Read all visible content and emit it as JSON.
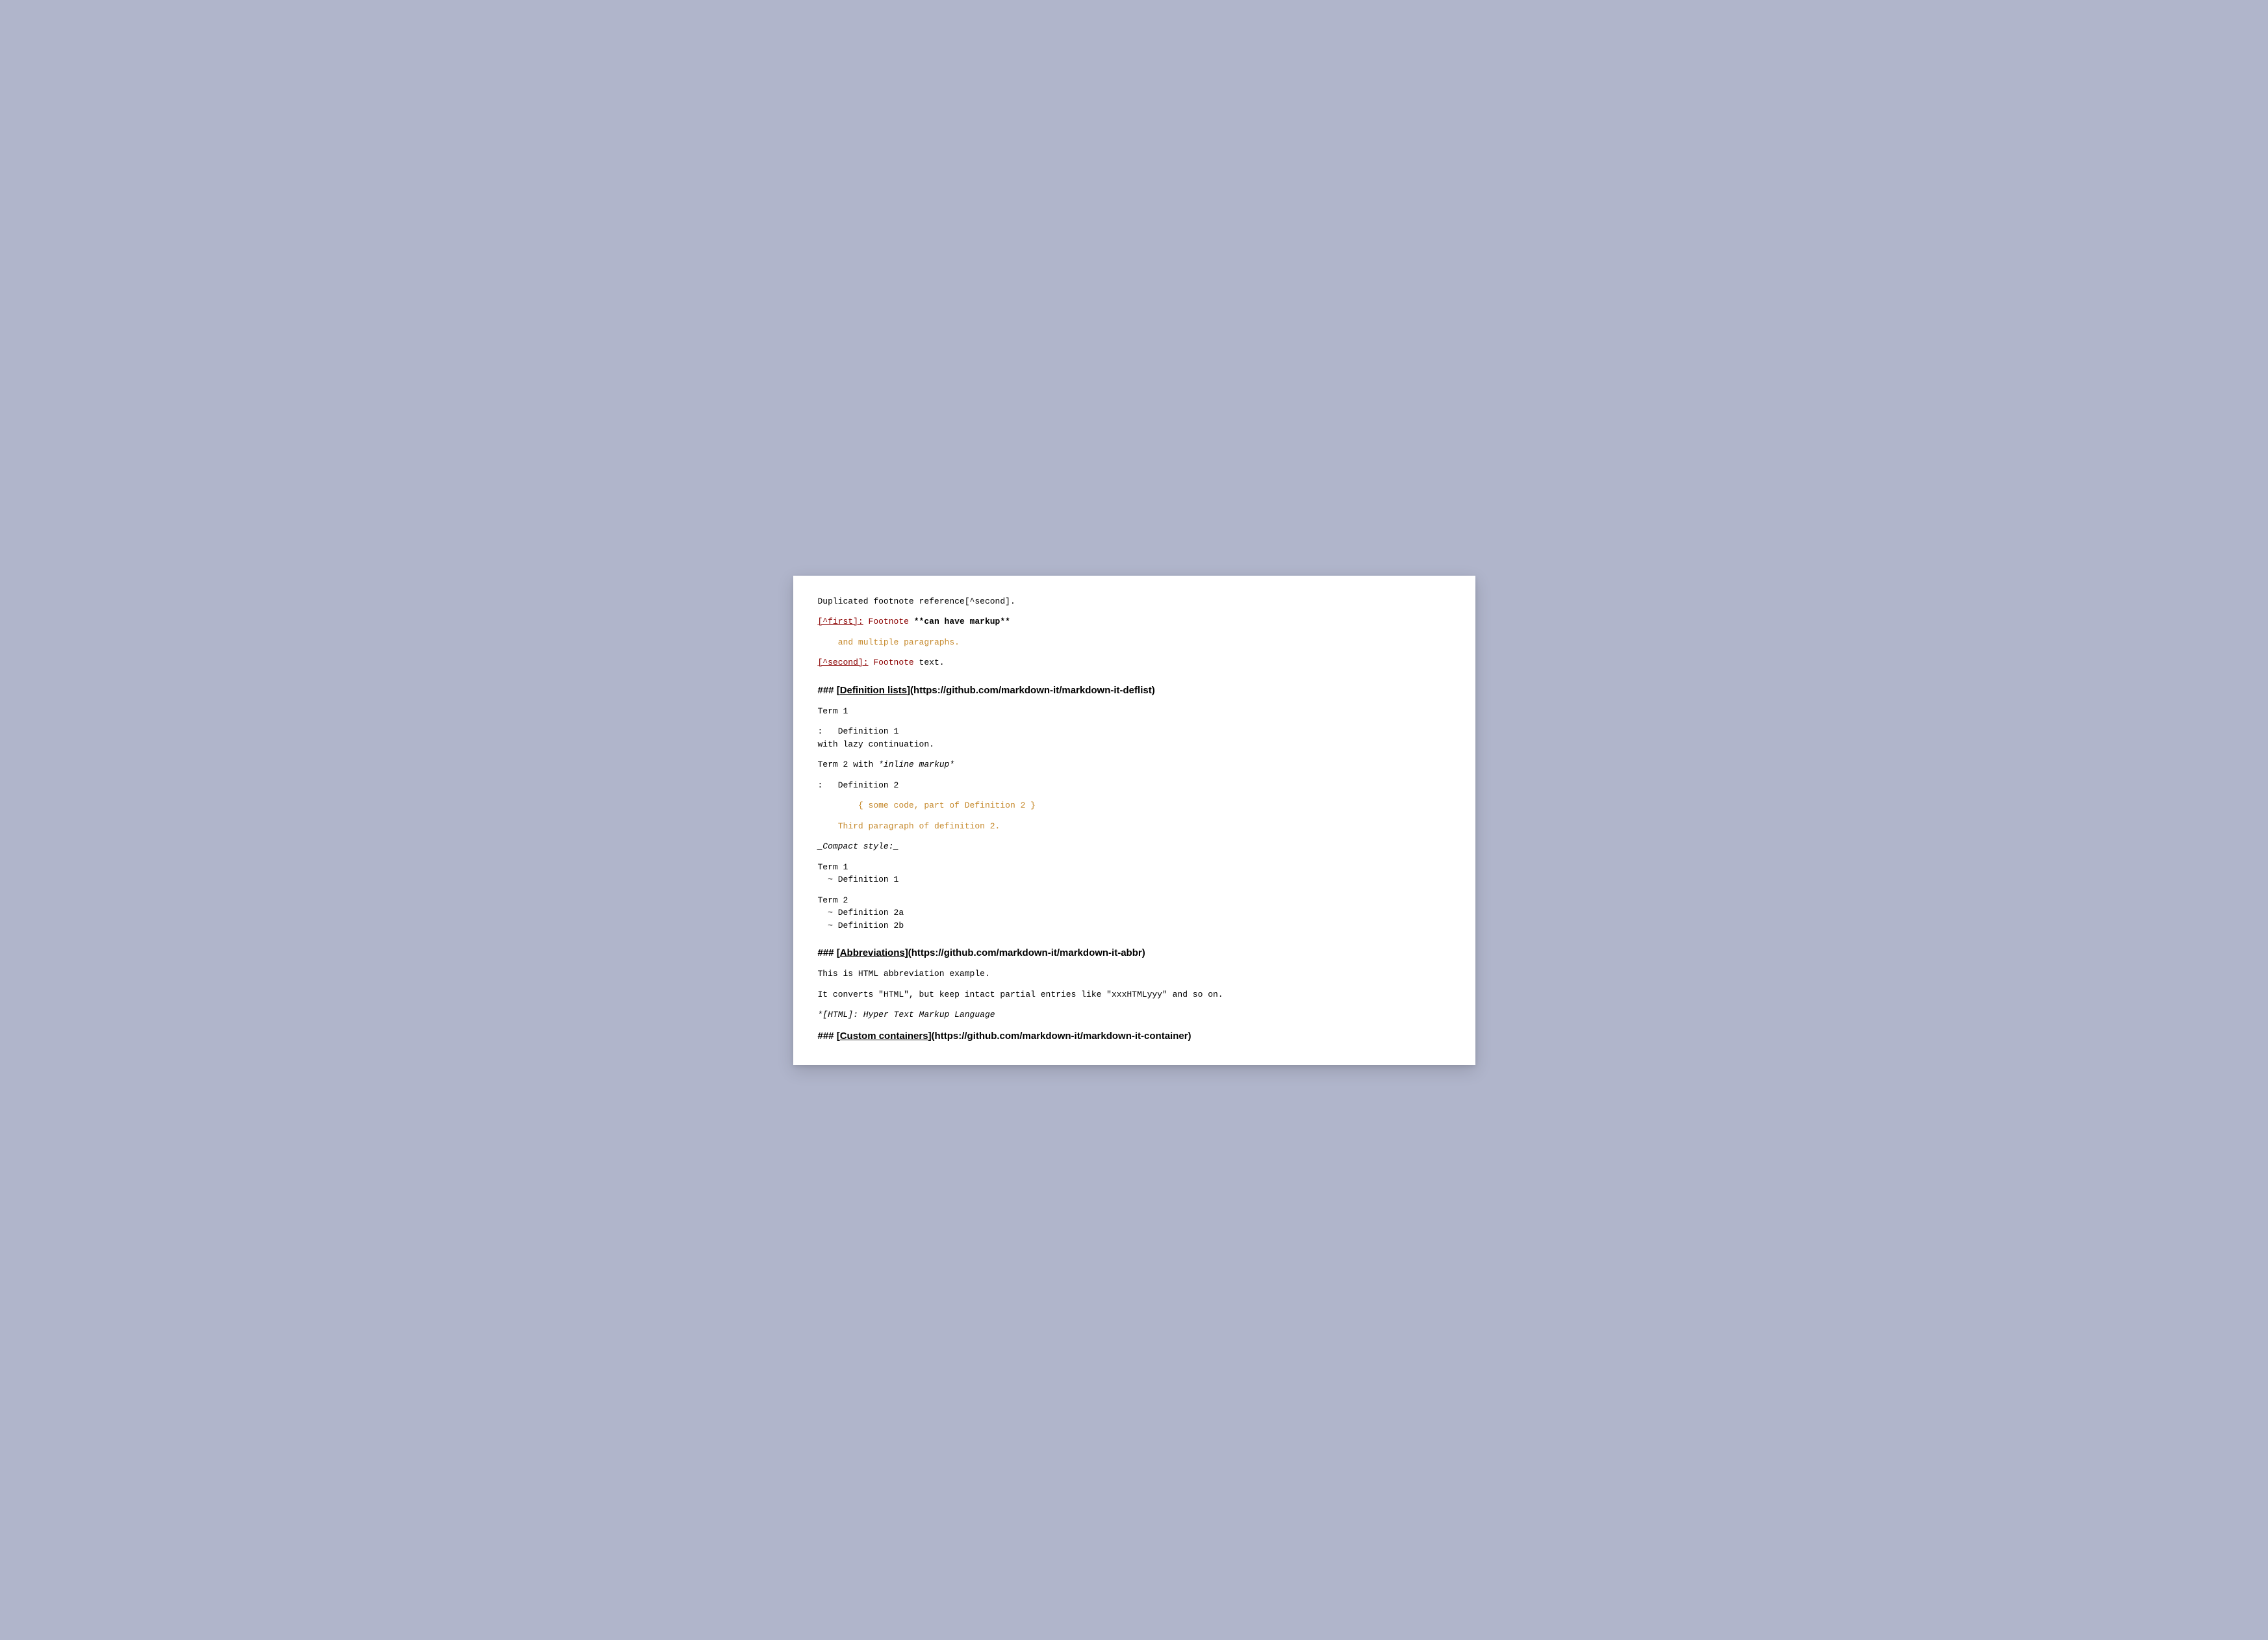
{
  "footnotes": {
    "dup_ref": "Duplicated footnote reference[^second].",
    "first_label": "[^first]:",
    "first_word": " Footnote ",
    "first_markup": "**can have markup**",
    "first_para2": "    and multiple paragraphs.",
    "second_label": "[^second]:",
    "second_word": " Footnote",
    "second_rest": " text."
  },
  "h_deflist": {
    "prefix": "### [",
    "link": "Definition lists",
    "suffix": "](https://github.com/markdown-it/markdown-it-deflist)"
  },
  "deflist": {
    "term1": "Term 1",
    "def1a": ":   Definition 1",
    "def1b": "with lazy continuation.",
    "term2a": "Term 2 with ",
    "term2b": "*inline markup*",
    "def2": ":   Definition 2",
    "code": "        { some code, part of Definition 2 }",
    "para3": "    Third paragraph of definition 2.",
    "compact": "_Compact style:_",
    "ct1": "Term 1",
    "cd1": "  ~ Definition 1",
    "ct2": "Term 2",
    "cd2a": "  ~ Definition 2a",
    "cd2b": "  ~ Definition 2b"
  },
  "h_abbr": {
    "prefix": "### [",
    "link": "Abbreviations",
    "suffix": "](https://github.com/markdown-it/markdown-it-abbr)"
  },
  "abbr": {
    "l1": "This is HTML abbreviation example.",
    "l2": "It converts \"HTML\", but keep intact partial entries like \"xxxHTMLyyy\" and so on.",
    "l3": "*[HTML]: Hyper Text Markup Language"
  },
  "h_container": {
    "prefix": "### [",
    "link": "Custom containers",
    "suffix": "](https://github.com/markdown-it/markdown-it-container)"
  }
}
